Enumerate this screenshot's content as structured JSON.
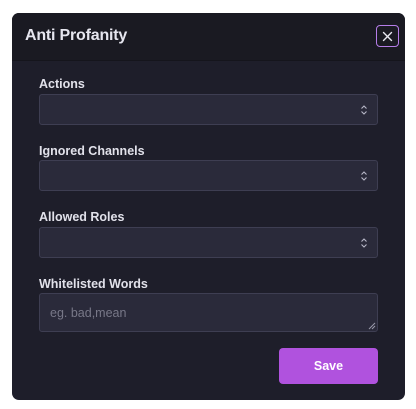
{
  "modal": {
    "title": "Anti Profanity",
    "close_icon": "close-icon"
  },
  "fields": {
    "actions": {
      "label": "Actions",
      "value": ""
    },
    "ignored_channels": {
      "label": "Ignored Channels",
      "value": ""
    },
    "allowed_roles": {
      "label": "Allowed Roles",
      "value": ""
    },
    "whitelisted_words": {
      "label": "Whitelisted Words",
      "placeholder": "eg. bad,mean",
      "value": ""
    }
  },
  "footer": {
    "save_label": "Save"
  },
  "colors": {
    "accent": "#b052de",
    "close_border": "#b57de8",
    "panel_bg": "#1e1e2a",
    "header_bg": "#1a1a22",
    "input_bg": "#2a2a3a"
  }
}
